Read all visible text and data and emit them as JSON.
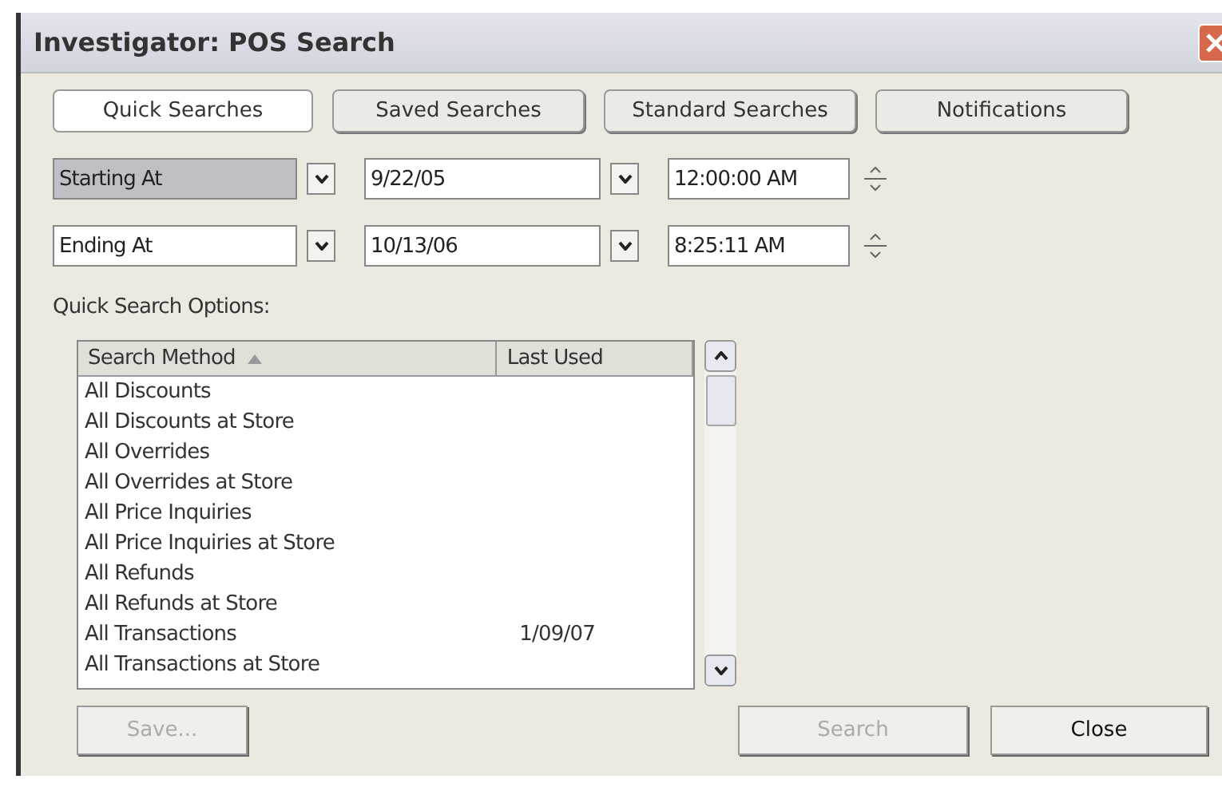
{
  "window": {
    "title": "Investigator: POS Search"
  },
  "tabs": [
    {
      "label": "Quick Searches",
      "selected": true
    },
    {
      "label": "Saved Searches",
      "selected": false
    },
    {
      "label": "Standard Searches",
      "selected": false
    },
    {
      "label": "Notifications",
      "selected": false
    }
  ],
  "range": [
    {
      "mode": "Starting At",
      "focused": true,
      "date": "9/22/05",
      "time": "12:00:00 AM"
    },
    {
      "mode": "Ending At",
      "focused": false,
      "date": "10/13/06",
      "time": "8:25:11 AM"
    }
  ],
  "options_label": "Quick Search Options:",
  "table": {
    "columns": [
      "Search Method",
      "Last Used"
    ],
    "rows": [
      [
        "All Discounts",
        ""
      ],
      [
        "All Discounts at Store",
        ""
      ],
      [
        "All Overrides",
        ""
      ],
      [
        "All Overrides at Store",
        ""
      ],
      [
        "All Price Inquiries",
        ""
      ],
      [
        "All Price Inquiries at Store",
        ""
      ],
      [
        "All Refunds",
        ""
      ],
      [
        "All Refunds at Store",
        ""
      ],
      [
        "All Transactions",
        "1/09/07"
      ],
      [
        "All Transactions at Store",
        ""
      ]
    ]
  },
  "buttons": [
    {
      "label": "Save...",
      "disabled": true
    },
    {
      "label": "Search",
      "disabled": true
    },
    {
      "label": "Close",
      "disabled": false
    }
  ]
}
